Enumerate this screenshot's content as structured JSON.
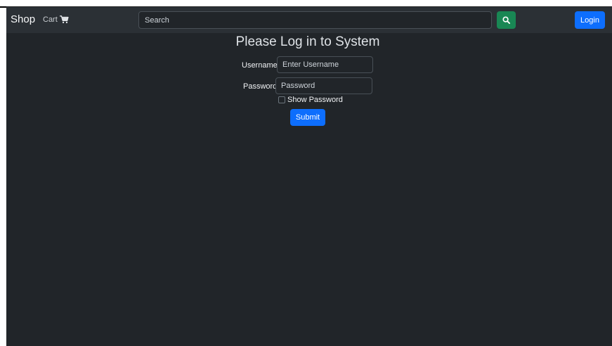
{
  "navbar": {
    "brand": "Shop",
    "cart_label": "Cart",
    "cart_icon": "shopping-cart-icon",
    "search_placeholder": "Search",
    "search_icon": "search-icon",
    "login_label": "Login"
  },
  "login_form": {
    "title": "Please Log in to System",
    "username_label": "Username",
    "username_placeholder": "Enter Username",
    "password_label": "Password",
    "password_placeholder": "Password",
    "show_password_label": "Show Password",
    "show_password_checked": false,
    "submit_label": "Submit"
  },
  "colors": {
    "background": "#212529",
    "navbar": "#2b3035",
    "primary": "#0d6efd",
    "success": "#198754"
  }
}
